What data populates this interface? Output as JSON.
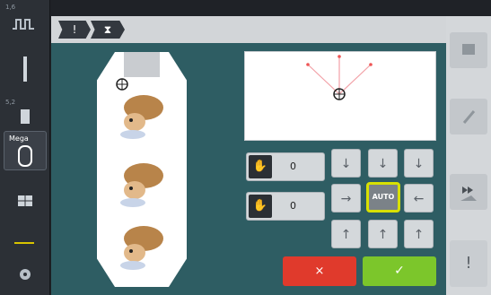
{
  "breadcrumb": [
    "!",
    "⧗"
  ],
  "left_sidebar": {
    "tags": [
      "1,6",
      "5,2",
      "Mega"
    ],
    "selected_label": "Mega"
  },
  "positions": {
    "field1": {
      "value": "0"
    },
    "field2": {
      "value": "0"
    }
  },
  "move_buttons": {
    "row1": [
      "↓",
      "↓",
      "↓"
    ],
    "row2_left": "→",
    "auto_label": "AUTO",
    "row2_right": "←",
    "row3": [
      "↑",
      "↑",
      "↑"
    ]
  },
  "actions": {
    "cancel": "×",
    "confirm": "✓"
  },
  "right_bar": {
    "bottom_mark": "!"
  },
  "colors": {
    "content_bg": "#2e5d63",
    "cancel": "#e03a2c",
    "confirm": "#7cc62b",
    "auto_border": "#d7e000"
  }
}
